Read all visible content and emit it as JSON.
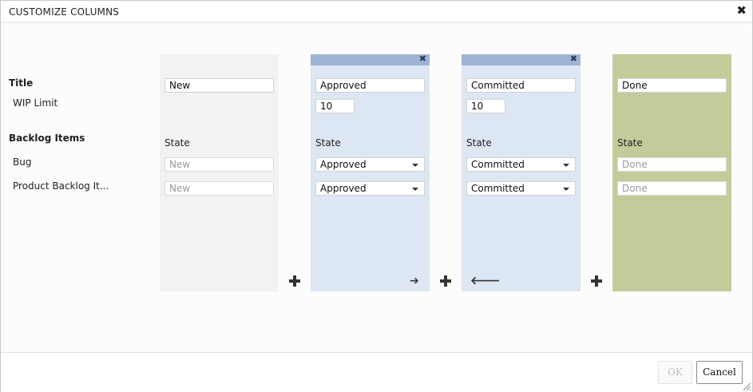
{
  "dialog": {
    "title": "CUSTOMIZE COLUMNS",
    "close_symbol": "✖"
  },
  "row_labels": {
    "title": "Title",
    "wip_limit": "WIP Limit",
    "backlog_items": "Backlog Items",
    "bug": "Bug",
    "product_backlog_item": "Product Backlog It..."
  },
  "columns": [
    {
      "title": "New",
      "state_label": "State",
      "bug_state": "New",
      "pbi_state": "New",
      "editable": false
    },
    {
      "title": "Approved",
      "wip_limit": "10",
      "state_label": "State",
      "bug_state": "Approved",
      "pbi_state": "Approved",
      "editable": true,
      "remove_symbol": "✖",
      "move_symbol": "➔"
    },
    {
      "title": "Committed",
      "wip_limit": "10",
      "state_label": "State",
      "bug_state": "Committed",
      "pbi_state": "Committed",
      "editable": true,
      "remove_symbol": "✖",
      "move_symbol": "🡐"
    },
    {
      "title": "Done",
      "state_label": "State",
      "bug_state": "Done",
      "pbi_state": "Done",
      "editable": false
    }
  ],
  "footer": {
    "ok_label": "OK",
    "cancel_label": "Cancel"
  },
  "icons": {
    "add_column": "plus-icon",
    "move_right": "arrow-right-icon",
    "move_left": "arrow-left-icon",
    "remove": "close-icon",
    "resize": "resize-grip-icon"
  },
  "colors": {
    "new_column_bg": "#f2f2f2",
    "editable_column_bg": "#dde6f3",
    "editable_column_header": "#9db4d4",
    "done_column_bg": "#c3cb9b"
  }
}
